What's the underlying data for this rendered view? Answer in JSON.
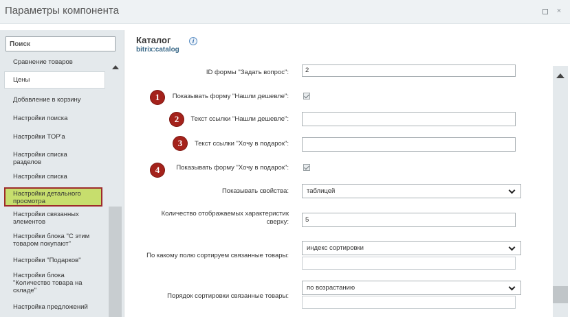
{
  "window": {
    "title": "Параметры компонента",
    "minimize_icon": "minimize-icon",
    "close_icon": "close-icon",
    "close_glyph": "×"
  },
  "sidebar": {
    "search_placeholder": "Поиск",
    "items": [
      {
        "label": "Сравнение товаров"
      },
      {
        "label": "Цены"
      },
      {
        "label": "Добавление в корзину"
      },
      {
        "label": "Настройки поиска"
      },
      {
        "label": "Настройки TOP'a"
      },
      {
        "label": "Настройки списка разделов"
      },
      {
        "label": "Настройки списка"
      },
      {
        "label": "Настройки детального просмотра"
      },
      {
        "label": "Настройки связанных элементов"
      },
      {
        "label": "Настройки блока \"С этим товаром покупают\""
      },
      {
        "label": "Настройки \"Подарков\""
      },
      {
        "label": "Настройки блока \"Количество товара на складе\""
      },
      {
        "label": "Настройка предложений"
      }
    ]
  },
  "main": {
    "title": "Каталог",
    "subtitle": "bitrix:catalog",
    "info_glyph": "i"
  },
  "form": {
    "ask_form_id": {
      "label": "ID формы \"Задать вопрос\":",
      "value": "2"
    },
    "show_cheaper_form": {
      "label": "Показывать форму \"Нашли дешевле\":",
      "checked": true,
      "badge": "1"
    },
    "cheaper_link_text": {
      "label": "Текст ссылки \"Нашли дешевле\":",
      "value": "",
      "badge": "2"
    },
    "gift_link_text": {
      "label": "Текст ссылки \"Хочу в подарок\":",
      "value": "",
      "badge": "3"
    },
    "show_gift_form": {
      "label": "Показывать форму \"Хочу в подарок\":",
      "checked": true,
      "badge": "4"
    },
    "show_properties": {
      "label": "Показывать свойства:",
      "value": "таблицей"
    },
    "props_count": {
      "label": "Количество отображаемых характеристик сверху:",
      "value": "5"
    },
    "related_sort_field": {
      "label": "По какому полю сортируем связанные товары:",
      "value": "индекс сортировки"
    },
    "related_sort_order": {
      "label": "Порядок сортировки связанные товары:",
      "value": "по возрастанию"
    }
  },
  "colors": {
    "badge": "#a4221b",
    "active_item_bg": "#c7de6d",
    "active_item_border": "#9e2b2b",
    "subtitle": "#3d6b8a"
  }
}
